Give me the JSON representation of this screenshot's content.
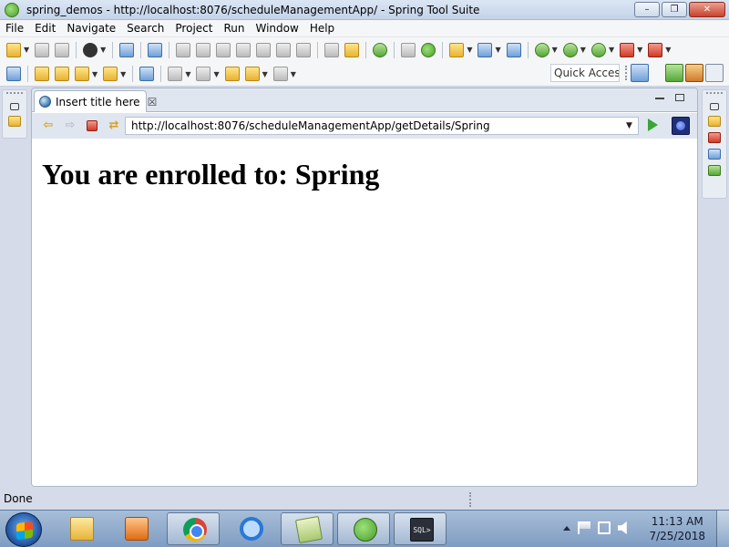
{
  "window": {
    "title": "spring_demos - http://localhost:8076/scheduleManagementApp/ - Spring Tool Suite",
    "minimize_glyph": "–",
    "restore_glyph": "❐",
    "close_glyph": "✕"
  },
  "menu": [
    "File",
    "Edit",
    "Navigate",
    "Search",
    "Project",
    "Run",
    "Window",
    "Help"
  ],
  "toolbar": {
    "quick_access": "Quick Access"
  },
  "editor": {
    "tab_title": "Insert title here",
    "tab_close_glyph": "☒",
    "url": "http://localhost:8076/scheduleManagementApp/getDetails/Spring",
    "nav_back_glyph": "⇦",
    "nav_forward_glyph": "⇨",
    "nav_refresh_glyph": "⇄",
    "dropdown_glyph": "▼"
  },
  "page": {
    "heading": "You are enrolled to: Spring"
  },
  "status": {
    "text": "Done"
  },
  "taskbar": {
    "sql_label": "SQL>",
    "time": "11:13 AM",
    "date": "7/25/2018"
  }
}
